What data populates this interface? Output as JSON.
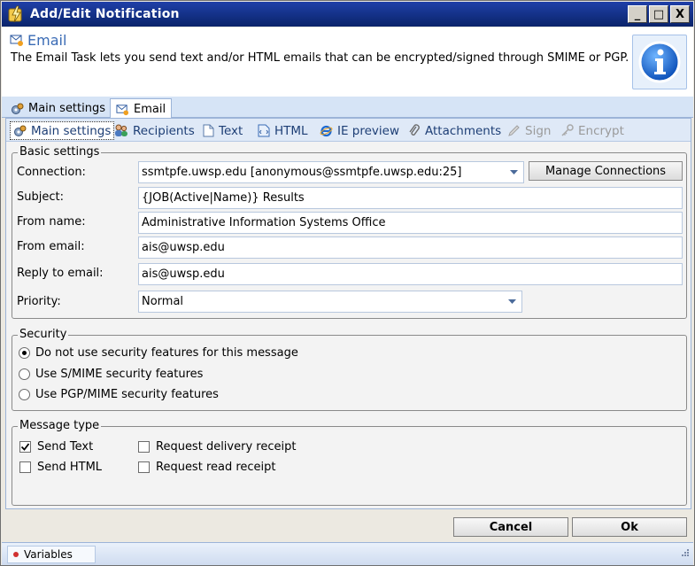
{
  "window": {
    "title": "Add/Edit Notification",
    "controls": [
      "_",
      "□",
      "X"
    ]
  },
  "header": {
    "title": "Email",
    "description": "The Email Task lets you send text and/or HTML emails that can be encrypted/signed through SMIME or PGP."
  },
  "outer_tabs": [
    {
      "label": "Main settings",
      "icon": "gears-icon"
    },
    {
      "label": "Email",
      "icon": "email-icon",
      "active": true
    }
  ],
  "inner_tabs": [
    {
      "label": "Main settings",
      "icon": "gears-icon",
      "active": true
    },
    {
      "label": "Recipients",
      "icon": "people-icon"
    },
    {
      "label": "Text",
      "icon": "page-icon"
    },
    {
      "label": "HTML",
      "icon": "html-icon"
    },
    {
      "label": "IE preview",
      "icon": "ie-icon"
    },
    {
      "label": "Attachments",
      "icon": "paperclip-icon"
    },
    {
      "label": "Sign",
      "icon": "pen-icon",
      "disabled": true
    },
    {
      "label": "Encrypt",
      "icon": "key-icon",
      "disabled": true
    }
  ],
  "basic": {
    "legend": "Basic settings",
    "connection_label": "Connection:",
    "connection_value": "ssmtpfe.uwsp.edu [anonymous@ssmtpfe.uwsp.edu:25]",
    "manage_button": "Manage Connections",
    "subject_label": "Subject:",
    "subject_value": "{JOB(Active|Name)} Results",
    "from_name_label": "From name:",
    "from_name_value": "Administrative Information Systems Office",
    "from_email_label": "From email:",
    "from_email_value": "ais@uwsp.edu",
    "reply_label": "Reply to email:",
    "reply_value": "ais@uwsp.edu",
    "priority_label": "Priority:",
    "priority_value": "Normal"
  },
  "security": {
    "legend": "Security",
    "options": [
      {
        "label": "Do not use security features for this message",
        "selected": true
      },
      {
        "label": "Use S/MIME security features",
        "selected": false
      },
      {
        "label": "Use PGP/MIME security features",
        "selected": false
      }
    ]
  },
  "message_type": {
    "legend": "Message type",
    "send_text": {
      "label": "Send Text",
      "checked": true
    },
    "send_html": {
      "label": "Send HTML",
      "checked": false
    },
    "delivery_receipt": {
      "label": "Request delivery receipt",
      "checked": false
    },
    "read_receipt": {
      "label": "Request read receipt",
      "checked": false
    }
  },
  "buttons": {
    "cancel": "Cancel",
    "ok": "Ok"
  },
  "status": {
    "variables": "Variables"
  },
  "colors": {
    "titlebar": "#0a246a",
    "accent": "#3a6bb5",
    "tabstrip": "#d6e4f6"
  }
}
